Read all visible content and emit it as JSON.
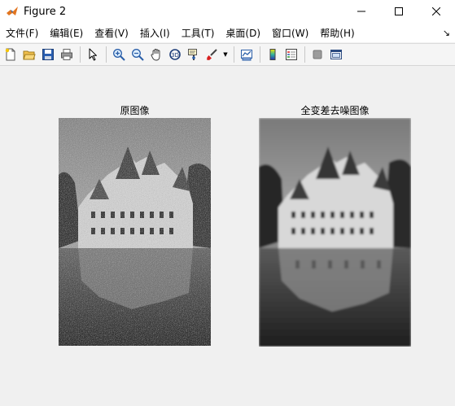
{
  "window": {
    "title": "Figure 2",
    "icon": "matlab-icon",
    "controls": [
      "minimize-icon",
      "maximize-icon",
      "close-icon"
    ]
  },
  "menubar": {
    "items": [
      {
        "label": "文件(F)"
      },
      {
        "label": "编辑(E)"
      },
      {
        "label": "查看(V)"
      },
      {
        "label": "插入(I)"
      },
      {
        "label": "工具(T)"
      },
      {
        "label": "桌面(D)"
      },
      {
        "label": "窗口(W)"
      },
      {
        "label": "帮助(H)"
      }
    ],
    "overflow_icon": "dock-arrow-icon"
  },
  "toolbar": {
    "buttons": [
      "new-figure-icon",
      "open-file-icon",
      "save-icon",
      "print-icon",
      "select-arrow-icon",
      "zoom-in-icon",
      "zoom-out-icon",
      "pan-icon",
      "rotate-3d-icon",
      "data-cursor-icon",
      "brush-icon",
      "link-plot-icon",
      "colorbar-icon",
      "legend-icon",
      "hide-plot-tools-icon",
      "show-plot-tools-icon"
    ]
  },
  "axes": [
    {
      "title": "原图像",
      "image": "noisy-castle-image"
    },
    {
      "title": "全变差去噪图像",
      "image": "denoised-castle-image"
    }
  ],
  "colors": {
    "window_bg": "#f0f0f0",
    "titlebar_bg": "#ffffff"
  }
}
